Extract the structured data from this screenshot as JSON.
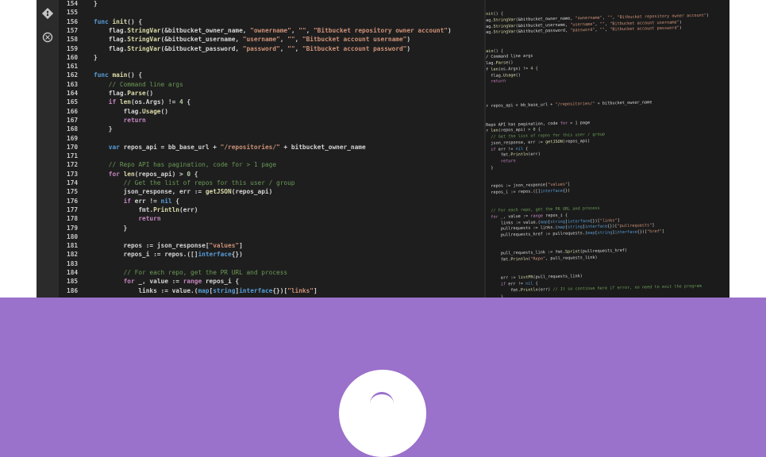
{
  "activity_bar": {
    "icons": [
      "git-icon",
      "settings-icon"
    ]
  },
  "left_code": [
    {
      "n": "154",
      "t": "}"
    },
    {
      "n": "155",
      "t": ""
    },
    {
      "n": "156",
      "t": "func init() {"
    },
    {
      "n": "157",
      "t": "    flag.StringVar(&bitbucket_owner_name, \"ownername\", \"\", \"Bitbucket repository owner account\")"
    },
    {
      "n": "158",
      "t": "    flag.StringVar(&bitbucket_username, \"username\", \"\", \"Bitbucket account username\")"
    },
    {
      "n": "159",
      "t": "    flag.StringVar(&bitbucket_password, \"password\", \"\", \"Bitbucket account password\")"
    },
    {
      "n": "160",
      "t": "}"
    },
    {
      "n": "161",
      "t": ""
    },
    {
      "n": "162",
      "t": "func main() {"
    },
    {
      "n": "163",
      "t": "    // Command line args"
    },
    {
      "n": "164",
      "t": "    flag.Parse()"
    },
    {
      "n": "165",
      "t": "    if len(os.Args) != 4 {"
    },
    {
      "n": "166",
      "t": "        flag.Usage()"
    },
    {
      "n": "167",
      "t": "        return"
    },
    {
      "n": "168",
      "t": "    }"
    },
    {
      "n": "169",
      "t": ""
    },
    {
      "n": "170",
      "t": "    var repos_api = bb_base_url + \"/repositories/\" + bitbucket_owner_name"
    },
    {
      "n": "171",
      "t": ""
    },
    {
      "n": "172",
      "t": "    // Repo API has pagination, code for > 1 page"
    },
    {
      "n": "173",
      "t": "    for len(repos_api) > 0 {"
    },
    {
      "n": "174",
      "t": "        // Get the list of repos for this user / group"
    },
    {
      "n": "175",
      "t": "        json_response, err := getJSON(repos_api)"
    },
    {
      "n": "176",
      "t": "        if err != nil {"
    },
    {
      "n": "177",
      "t": "            fmt.Println(err)"
    },
    {
      "n": "178",
      "t": "            return"
    },
    {
      "n": "179",
      "t": "        }"
    },
    {
      "n": "180",
      "t": ""
    },
    {
      "n": "181",
      "t": "        repos := json_response[\"values\"]"
    },
    {
      "n": "182",
      "t": "        repos_i := repos.([]interface{})"
    },
    {
      "n": "183",
      "t": ""
    },
    {
      "n": "184",
      "t": "        // For each repo, get the PR URL and process"
    },
    {
      "n": "185",
      "t": "        for _, value := range repos_i {"
    },
    {
      "n": "186",
      "t": "            links := value.(map[string]interface{})[\"links\"]"
    }
  ],
  "right_code": [
    "nit() {",
    "ag.StringVar(&bitbucket_owner_name, \"ownername\", \"\", \"Bitbucket repository owner account\")",
    "ag.StringVar(&bitbucket_username, \"username\", \"\", \"Bitbucket account username\")",
    "ag.StringVar(&bitbucket_password, \"password\", \"\", \"Bitbucket account password\")",
    "",
    "",
    "ain() {",
    "/ Command line args",
    "lag.Parse()",
    "f len(os.Args) != 4 {",
    "  flag.Usage()",
    "  return",
    "",
    "",
    "",
    "r repos_api = bb_base_url + \"/repositories/\" + bitbucket_owner_name",
    "",
    "",
    "Repo API has pagination, code for > 1 page",
    "r len(repos_api) > 0 {",
    "  // Get the list of repos for this user / group",
    "  json_response, err := getJSON(repos_api)",
    "  if err != nil {",
    "      fmt.Println(err)",
    "      return",
    "  }",
    "",
    "",
    "  repos := json_response[\"values\"]",
    "  repos_i := repos.([]interface{})",
    "",
    "",
    "  // For each repo, get the PR URL and process",
    "  for _, value := range repos_i {",
    "      links := value.(map[string]interface{})[\"links\"]",
    "      pullrequests := links.(map[string]interface{})[\"pullrequests\"]",
    "      pullrequests_href := pullrequests.(map[string]interface{})[\"href\"]",
    "",
    "",
    "      pull_requests_link := fmt.Sprint(pullrequests_href)",
    "      fmt.Println(\"Repo\", pull_requests_link)",
    "",
    "",
    "      err := listPR(pull_requests_link)",
    "      if err != nil {",
    "          fmt.Println(err) // It so continue here if error, no need to exit the program",
    "      }",
    "  }"
  ],
  "colors": {
    "background": "#9A71CB",
    "editor": "#1E1E1E",
    "keyword": "#569CD6",
    "string": "#CE9178",
    "comment": "#6A9955",
    "function": "#DCDCAA"
  }
}
